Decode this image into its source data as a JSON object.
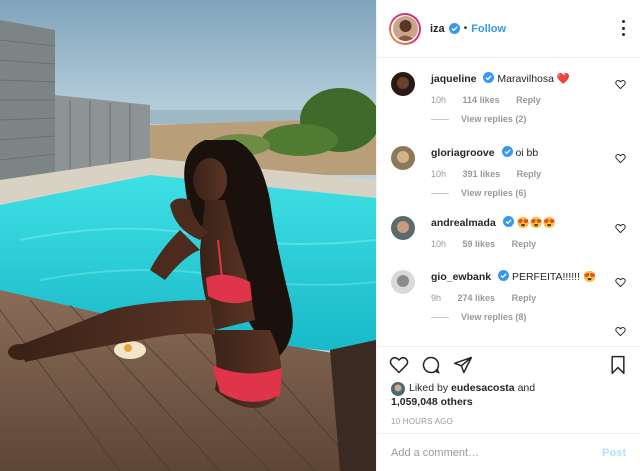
{
  "author": {
    "username": "iza",
    "follow_label": "Follow",
    "separator": "•"
  },
  "comments": [
    {
      "username": "jaqueline",
      "text": "Maravilhosa",
      "emoji": "❤️",
      "age": "10h",
      "likes": "114 likes",
      "reply_label": "Reply",
      "view_replies": "View replies (2)"
    },
    {
      "username": "gloriagroove",
      "text": "oi bb",
      "emoji": "",
      "age": "10h",
      "likes": "391 likes",
      "reply_label": "Reply",
      "view_replies": "View replies (6)"
    },
    {
      "username": "andrealmada",
      "text": "",
      "emoji": "😍😍😍",
      "age": "10h",
      "likes": "59 likes",
      "reply_label": "Reply",
      "view_replies": ""
    },
    {
      "username": "gio_ewbank",
      "text": "PERFEITA!!!!!!",
      "emoji": "😍",
      "age": "9h",
      "likes": "274 likes",
      "reply_label": "Reply",
      "view_replies": "View replies (8)"
    }
  ],
  "likes": {
    "prefix": "Liked by",
    "user": "eudesacosta",
    "joiner": "and",
    "others": "1,059,048 others"
  },
  "timestamp": "10 HOURS AGO",
  "add_comment": {
    "placeholder": "Add a comment…",
    "post_label": "Post"
  },
  "colors": {
    "accent": "#3897f0",
    "pool": "#2fd1d6",
    "sky": "#8fb2c8",
    "deck": "#7a5f4f"
  },
  "icons": [
    "verified-icon",
    "more-icon",
    "heart-icon",
    "comment-icon",
    "share-icon",
    "bookmark-icon"
  ]
}
